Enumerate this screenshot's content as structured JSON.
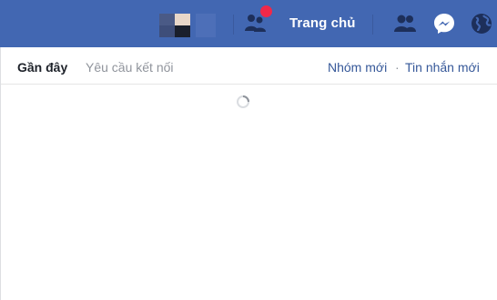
{
  "topbar": {
    "background": "#4267b2",
    "home_label": "Trang chủ",
    "icons": [
      "friend-requests-icon",
      "friends-icon",
      "messenger-icon",
      "globe-icon"
    ],
    "notification_badge_color": "#f02849"
  },
  "messages_panel": {
    "tabs": {
      "recent": "Gần đây",
      "requests": "Yêu cầu kết nối"
    },
    "actions": {
      "new_group": "Nhóm mới",
      "separator": "·",
      "new_message": "Tin nhắn mới"
    },
    "loading": true,
    "link_color": "#365899"
  }
}
